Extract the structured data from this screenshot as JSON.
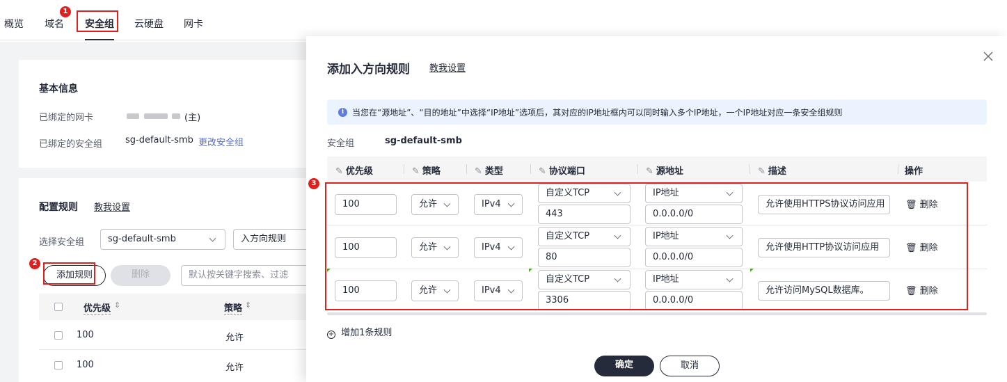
{
  "top_tabs": [
    "概览",
    "域名",
    "安全组",
    "云硬盘",
    "网卡"
  ],
  "badges": {
    "b1": "1",
    "b2": "2",
    "b3": "3"
  },
  "basic_info": {
    "title": "基本信息",
    "nic_label": "已绑定的网卡",
    "nic_suffix": "(主)",
    "sg_label": "已绑定的安全组",
    "sg_value": "sg-default-smb",
    "change_link": "更改安全组"
  },
  "config": {
    "title": "配置规则",
    "help_link": "教我设置",
    "select_sg_label": "选择安全组",
    "sg_select_value": "sg-default-smb",
    "direction_value": "入方向规则",
    "add_rule_button": "添加规则",
    "delete_button": "删除",
    "search_placeholder": "默认按关键字搜索、过滤",
    "columns": [
      "优先级",
      "策略"
    ],
    "rows": [
      {
        "priority": "100",
        "policy": "允许"
      },
      {
        "priority": "100",
        "policy": "允许"
      }
    ]
  },
  "dialog": {
    "title": "添加入方向规则",
    "help_link": "教我设置",
    "info_text": "当您在“源地址”、“目的地址”中选择“IP地址”选项后，其对应的IP地址框内可以同时输入多个IP地址，一个IP地址对应一条安全组规则",
    "sg_label": "安全组",
    "sg_value": "sg-default-smb",
    "columns": [
      "优先级",
      "策略",
      "类型",
      "协议端口",
      "源地址",
      "描述",
      "操作"
    ],
    "rules": [
      {
        "priority": "100",
        "policy": "允许",
        "type": "IPv4",
        "protocol": "自定义TCP",
        "port": "443",
        "source_type": "IP地址",
        "source": "0.0.0.0/0",
        "desc": "允许使用HTTPS协议访问应用",
        "delete": "删除"
      },
      {
        "priority": "100",
        "policy": "允许",
        "type": "IPv4",
        "protocol": "自定义TCP",
        "port": "80",
        "source_type": "IP地址",
        "source": "0.0.0.0/0",
        "desc": "允许使用HTTP协议访问应用",
        "delete": "删除"
      },
      {
        "priority": "100",
        "policy": "允许",
        "type": "IPv4",
        "protocol": "自定义TCP",
        "port": "3306",
        "source_type": "IP地址",
        "source": "0.0.0.0/0",
        "desc": "允许访问MySQL数据库。",
        "delete": "删除"
      }
    ],
    "add_one_rule": "增加1条规则",
    "confirm_button": "确定",
    "cancel_button": "取消"
  },
  "icons": {
    "close": "close-icon",
    "info": "info-icon",
    "delete": "trash-icon",
    "add": "plus-circle-icon",
    "edit": "pencil-icon",
    "sort": "sort-icon"
  },
  "colors": {
    "highlight": "#e0201e",
    "link": "#526ecc",
    "primary_button": "#252b3a",
    "info_bg": "#ebf3fe"
  }
}
